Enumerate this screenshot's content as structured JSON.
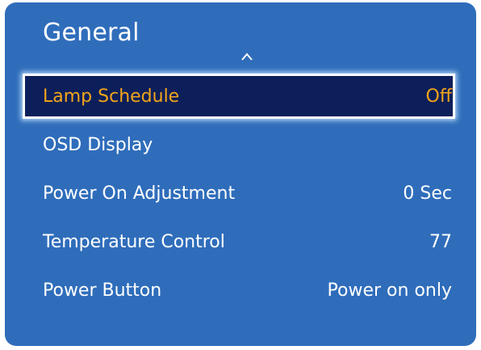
{
  "menu": {
    "title": "General",
    "scroll_icon": "chevron-up-icon",
    "items": [
      {
        "label": "Lamp Schedule",
        "value": "Off"
      },
      {
        "label": "OSD Display",
        "value": ""
      },
      {
        "label": "Power On Adjustment",
        "value": "0 Sec"
      },
      {
        "label": "Temperature Control",
        "value": "77"
      },
      {
        "label": "Power Button",
        "value": "Power on only"
      }
    ],
    "selected_index": 0
  },
  "colors": {
    "panel_background": "#2f6dbb",
    "selected_background": "#0d1f5a",
    "selected_text": "#f2a51a",
    "text": "#ffffff"
  }
}
